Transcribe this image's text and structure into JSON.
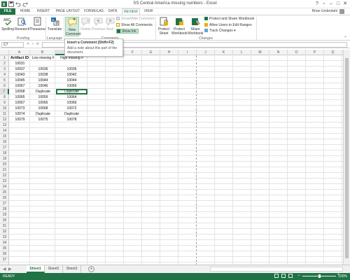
{
  "window": {
    "title": "SS Central America missing numbers - Excel",
    "user": "Brian Underdahl"
  },
  "tabs": [
    "FILE",
    "HOME",
    "INSERT",
    "PAGE LAYOUT",
    "FORMULAS",
    "DATA",
    "REVIEW",
    "VIEW"
  ],
  "active_tab": "REVIEW",
  "ribbon": {
    "spelling": "Spelling",
    "research": "Research",
    "thesaurus": "Thesaurus",
    "translate": "Translate",
    "new_comment": "New Comment",
    "delete": "Delete",
    "previous": "Previous",
    "next": "Next",
    "show_hide_comment": "Show/Hide Comment",
    "show_all_comments": "Show All Comments",
    "show_ink": "Show Ink",
    "protect_sheet": "Protect Sheet",
    "protect_workbook": "Protect Workbook",
    "share_workbook": "Share Workbook",
    "protect_share_workbook": "Protect and Share Workbook",
    "allow_users_edit": "Allow Users to Edit Ranges",
    "track_changes": "Track Changes",
    "groups": {
      "proofing": "Proofing",
      "language": "Language",
      "comments": "Comments",
      "changes": "Changes"
    }
  },
  "tooltip": {
    "title": "Insert a Comment (Shift+F2)",
    "body": "Add a note about this part of the document."
  },
  "formula_bar": {
    "name_box": "C7",
    "value": ""
  },
  "columns": [
    "A",
    "B",
    "C",
    "D",
    "E",
    "F",
    "G",
    "H",
    "I",
    "J",
    "K",
    "L",
    "M",
    "N",
    "O",
    "P",
    "Q"
  ],
  "rows": [
    "1",
    "2",
    "3",
    "4",
    "5",
    "6",
    "7",
    "8",
    "9",
    "10",
    "11",
    "12",
    "13",
    "14",
    "15",
    "16",
    "17",
    "18",
    "19",
    "20",
    "21",
    "22",
    "23",
    "24",
    "25",
    "26",
    "27",
    "28",
    "29",
    "30",
    "31",
    "32",
    "33",
    "34",
    "35",
    "36",
    "37"
  ],
  "sheet": {
    "headers": [
      "Artifact ID",
      "Low missing #",
      "High missing #"
    ],
    "data": [
      [
        "10031",
        "",
        ""
      ],
      [
        "10037",
        "10036",
        "10036"
      ],
      [
        "10043",
        "10038",
        "10042"
      ],
      [
        "10045",
        "10044",
        "10044"
      ],
      [
        "10057",
        "10046",
        "10056"
      ],
      [
        "10058",
        "Duplicate",
        "Duplicate"
      ],
      [
        "10065",
        "10059",
        "10064"
      ],
      [
        "10067",
        "10066",
        "10066"
      ],
      [
        "10073",
        "10068",
        "10072"
      ],
      [
        "10074",
        "Duplicate",
        "Duplicate"
      ],
      [
        "10079",
        "10075",
        "10078"
      ]
    ],
    "selected_cell": "C7"
  },
  "sheet_tabs": [
    "Sheet1",
    "Sheet2",
    "Sheet3"
  ],
  "active_sheet": "Sheet1",
  "status": {
    "ready": "READY",
    "zoom": "100%"
  },
  "colors": {
    "accent": "#217346",
    "selection": "#217346",
    "hover": "#d5e9dc"
  }
}
